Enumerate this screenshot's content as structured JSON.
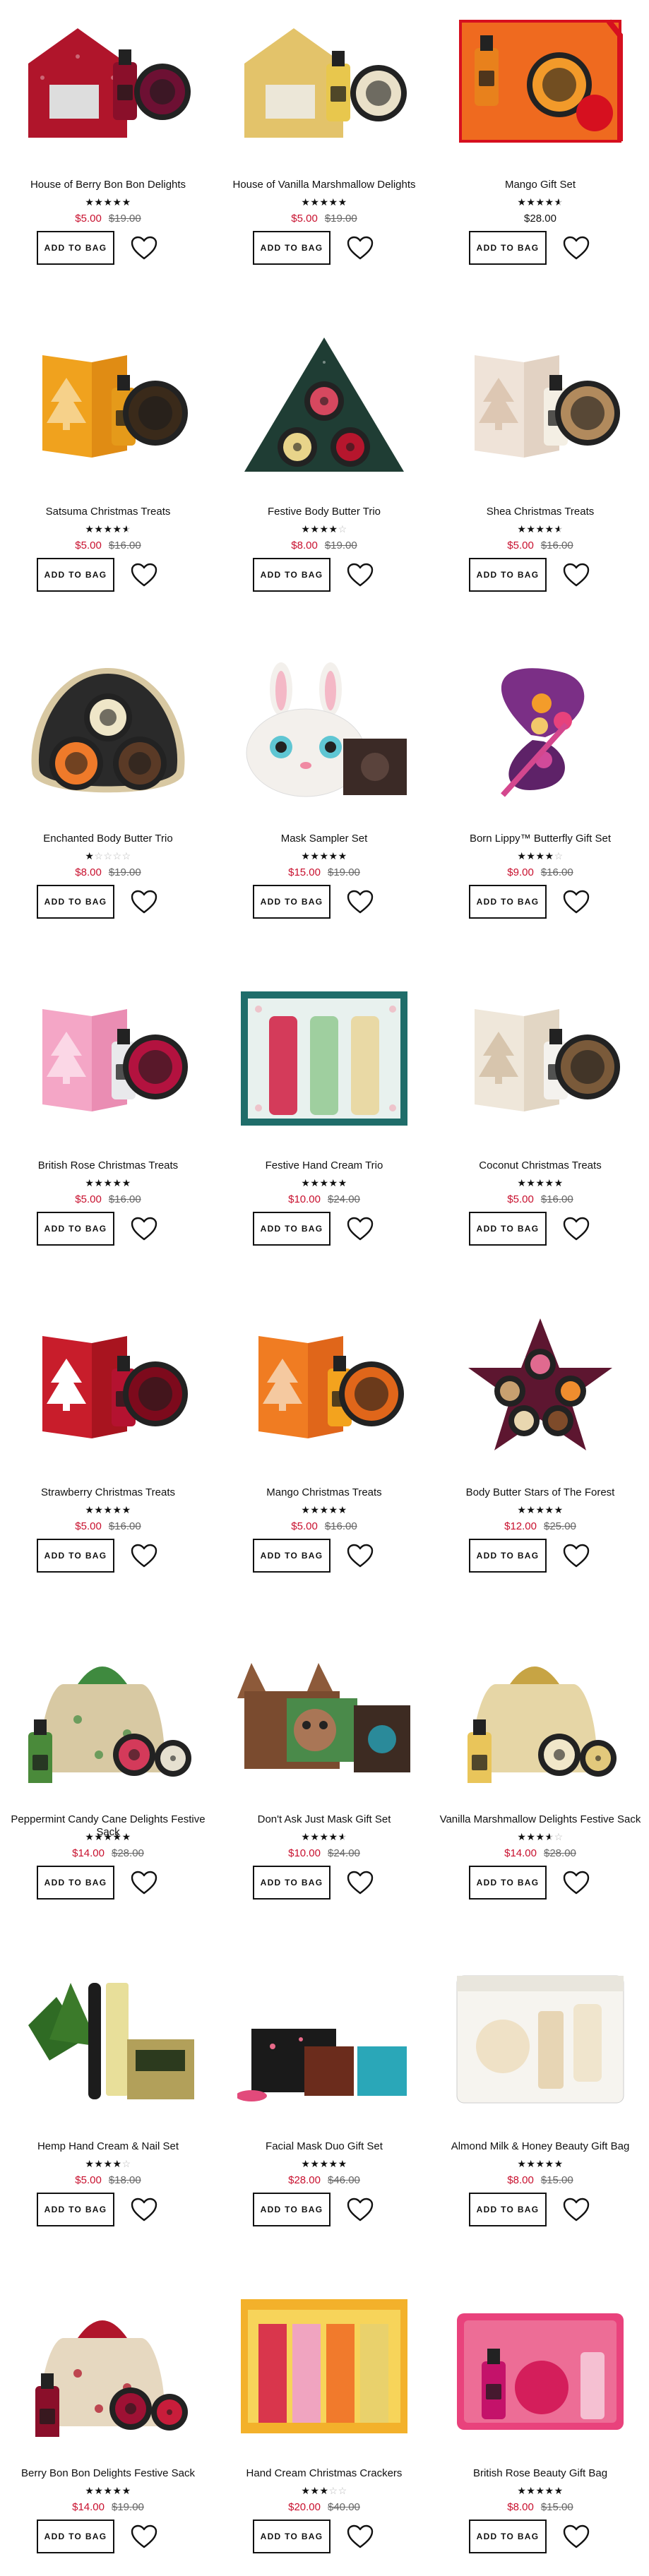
{
  "labels": {
    "add_to_bag": "ADD TO BAG"
  },
  "products": [
    {
      "name": "House of Berry Bon Bon Delights",
      "price": "$5.00",
      "was": "$19.00",
      "rating": 5,
      "art": "house-red"
    },
    {
      "name": "House of Vanilla Marshmallow Delights",
      "price": "$5.00",
      "was": "$19.00",
      "rating": 5,
      "art": "house-gold"
    },
    {
      "name": "Mango Gift Set",
      "price": "$28.00",
      "was": "",
      "rating": 4.5,
      "art": "mango-box"
    },
    {
      "name": "Satsuma Christmas Treats",
      "price": "$5.00",
      "was": "$16.00",
      "rating": 4.5,
      "art": "box-orange"
    },
    {
      "name": "Festive Body Butter Trio",
      "price": "$8.00",
      "was": "$19.00",
      "rating": 4,
      "art": "triangle-green"
    },
    {
      "name": "Shea Christmas Treats",
      "price": "$5.00",
      "was": "$16.00",
      "rating": 4.5,
      "art": "box-cream"
    },
    {
      "name": "Enchanted Body Butter Trio",
      "price": "$8.00",
      "was": "$19.00",
      "rating": 1,
      "art": "triangle-tin"
    },
    {
      "name": "Mask Sampler Set",
      "price": "$15.00",
      "was": "$19.00",
      "rating": 5,
      "art": "bunny"
    },
    {
      "name": "Born Lippy™ Butterfly Gift Set",
      "price": "$9.00",
      "was": "$16.00",
      "rating": 4,
      "art": "butterfly"
    },
    {
      "name": "British Rose Christmas Treats",
      "price": "$5.00",
      "was": "$16.00",
      "rating": 5,
      "art": "box-pink"
    },
    {
      "name": "Festive Hand Cream Trio",
      "price": "$10.00",
      "was": "$24.00",
      "rating": 5,
      "art": "hand-trio"
    },
    {
      "name": "Coconut Christmas Treats",
      "price": "$5.00",
      "was": "$16.00",
      "rating": 5,
      "art": "box-cream2"
    },
    {
      "name": "Strawberry Christmas Treats",
      "price": "$5.00",
      "was": "$16.00",
      "rating": 5,
      "art": "box-red"
    },
    {
      "name": "Mango Christmas Treats",
      "price": "$5.00",
      "was": "$16.00",
      "rating": 5,
      "art": "box-orange2"
    },
    {
      "name": "Body Butter Stars of The Forest",
      "price": "$12.00",
      "was": "$25.00",
      "rating": 5,
      "art": "star"
    },
    {
      "name": "Peppermint Candy Cane Delights Festive Sack",
      "price": "$14.00",
      "was": "$28.00",
      "rating": 5,
      "art": "sack-green"
    },
    {
      "name": "Don't Ask Just Mask Gift Set",
      "price": "$10.00",
      "was": "$24.00",
      "rating": 4.5,
      "art": "deer"
    },
    {
      "name": "Vanilla Marshmallow Delights Festive Sack",
      "price": "$14.00",
      "was": "$28.00",
      "rating": 3.5,
      "art": "sack-gold"
    },
    {
      "name": "Hemp Hand Cream & Nail Set",
      "price": "$5.00",
      "was": "$18.00",
      "rating": 4,
      "art": "hemp"
    },
    {
      "name": "Facial Mask Duo Gift Set",
      "price": "$28.00",
      "was": "$46.00",
      "rating": 5,
      "art": "mask-duo"
    },
    {
      "name": "Almond Milk & Honey Beauty Gift Bag",
      "price": "$8.00",
      "was": "$15.00",
      "rating": 5,
      "art": "bag-white"
    },
    {
      "name": "Berry Bon Bon Delights Festive Sack",
      "price": "$14.00",
      "was": "$19.00",
      "rating": 5,
      "art": "sack-red"
    },
    {
      "name": "Hand Cream Christmas Crackers",
      "price": "$20.00",
      "was": "$40.00",
      "rating": 3,
      "art": "crackers"
    },
    {
      "name": "British Rose Beauty Gift Bag",
      "price": "$8.00",
      "was": "$15.00",
      "rating": 5,
      "art": "bag-pink"
    }
  ]
}
